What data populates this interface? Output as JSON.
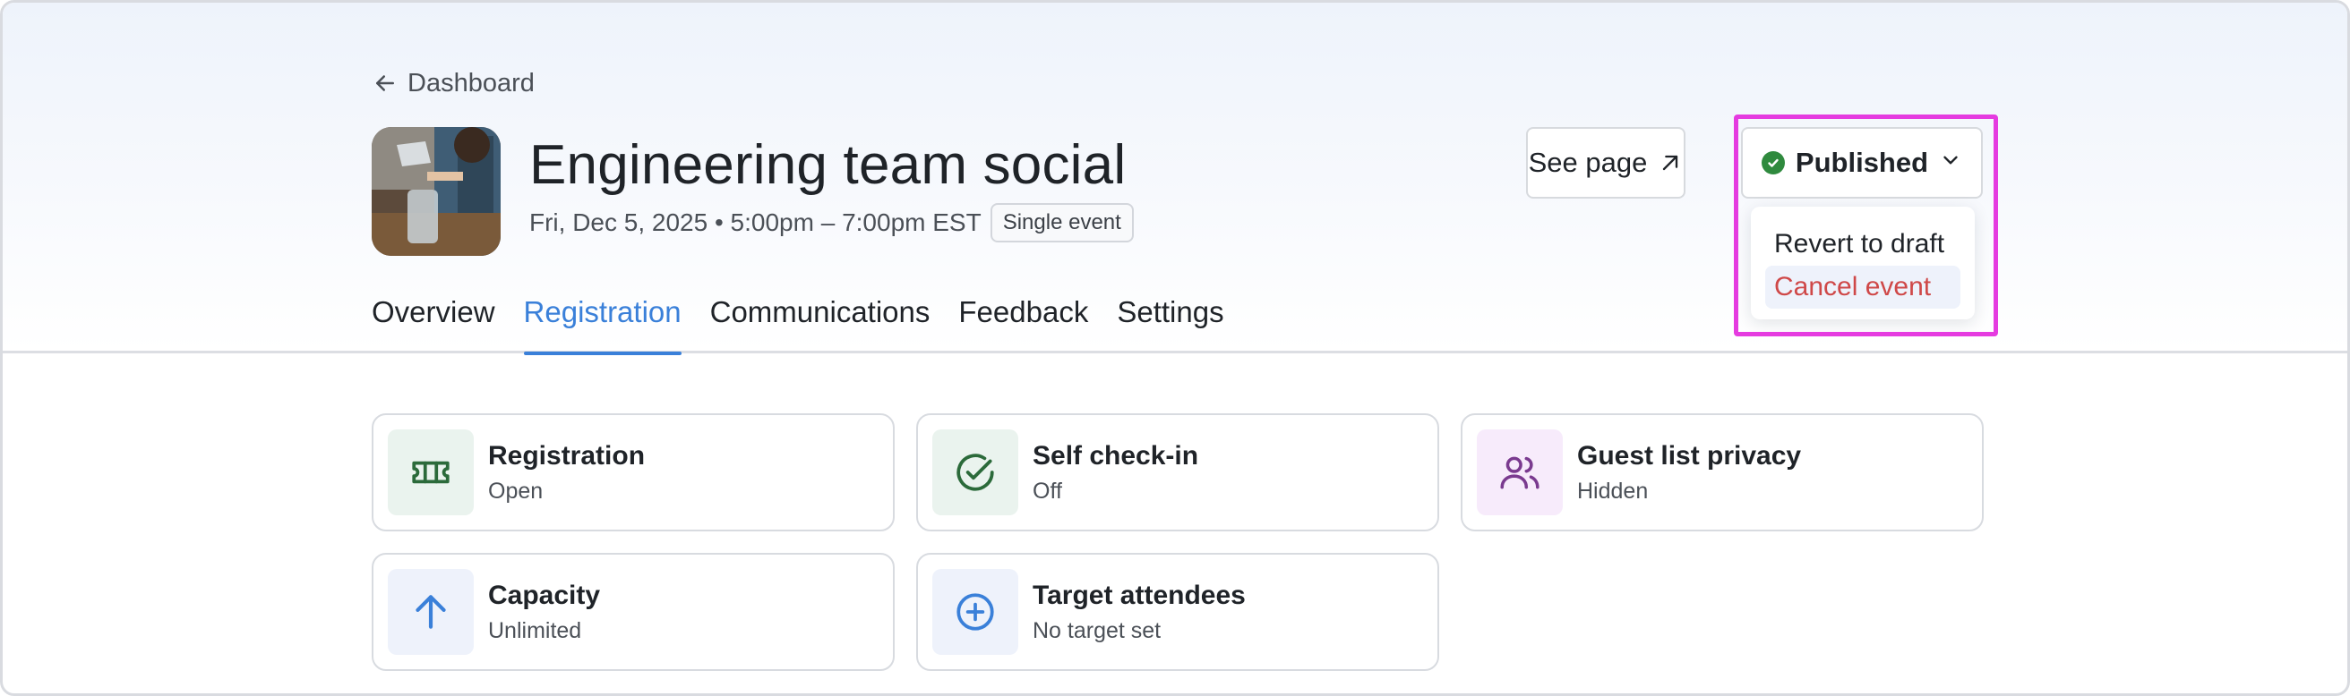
{
  "back": {
    "label": "Dashboard",
    "icon": "arrow-left-icon"
  },
  "event": {
    "title": "Engineering team social",
    "date_time": "Fri, Dec 5, 2025 • 5:00pm – 7:00pm EST",
    "badge": "Single event"
  },
  "tabs": [
    {
      "label": "Overview",
      "active": false
    },
    {
      "label": "Registration",
      "active": true
    },
    {
      "label": "Communications",
      "active": false
    },
    {
      "label": "Feedback",
      "active": false
    },
    {
      "label": "Settings",
      "active": false
    }
  ],
  "actions": {
    "see_page": "See page",
    "status": "Published",
    "status_color": "#2f8a3e"
  },
  "status_menu": {
    "items": [
      {
        "label": "Revert to draft"
      },
      {
        "label": "Cancel event",
        "color": "#cf4848"
      }
    ]
  },
  "settings_cards": [
    {
      "label": "Registration",
      "value": "Open",
      "icon": "ticket-icon"
    },
    {
      "label": "Self check-in",
      "value": "Off",
      "icon": "check-circle-icon"
    },
    {
      "label": "Guest list privacy",
      "value": "Hidden",
      "icon": "users-icon"
    },
    {
      "label": "Capacity",
      "value": "Unlimited",
      "icon": "arrow-up-icon"
    },
    {
      "label": "Target attendees",
      "value": "No target set",
      "icon": "plus-circle-icon"
    }
  ],
  "colors": {
    "accent": "#3a80d9",
    "highlight": "#e53be0",
    "danger": "#cf4848"
  }
}
